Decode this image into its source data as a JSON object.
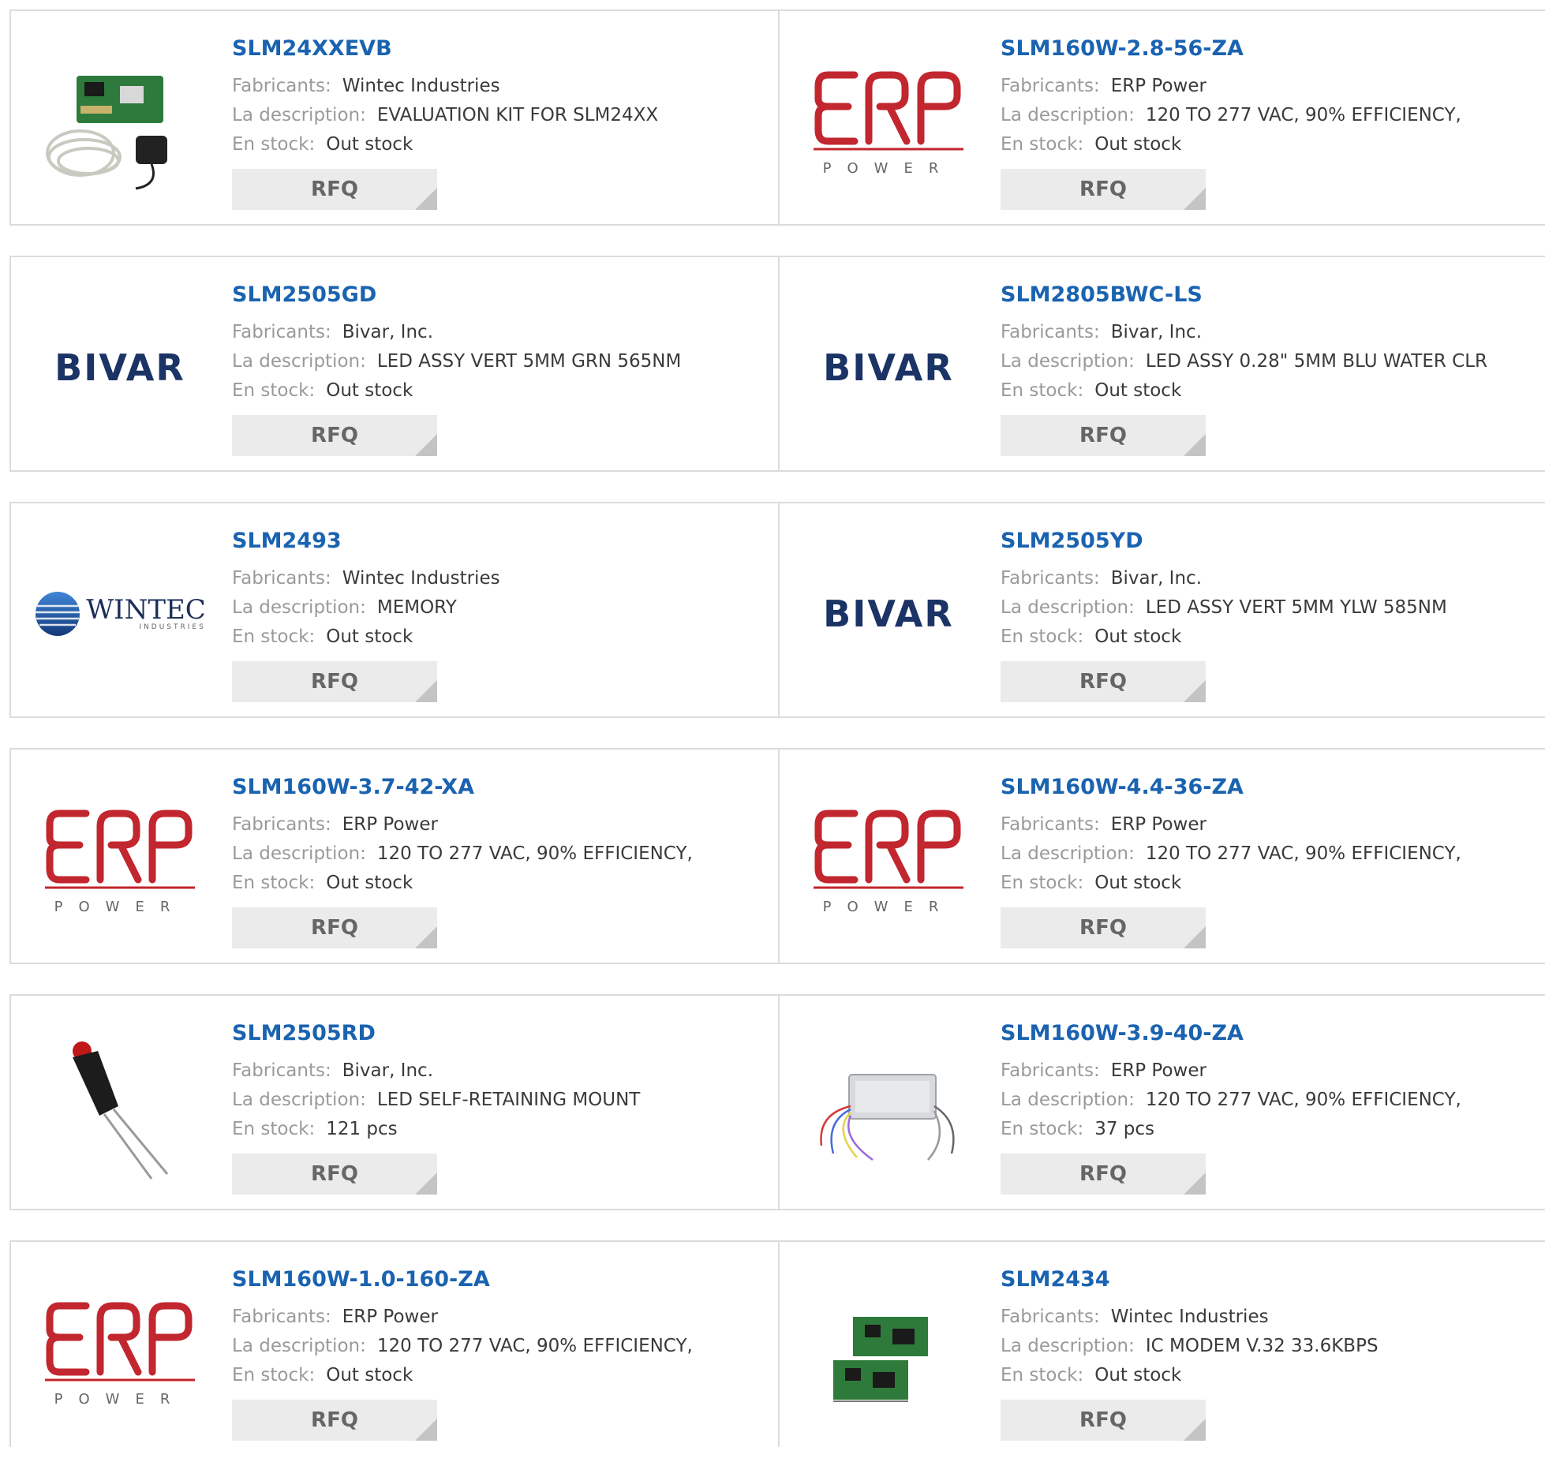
{
  "labels": {
    "manufacturer": "Fabricants:",
    "description": "La description:",
    "stock": "En stock:",
    "rfq": "RFQ"
  },
  "products": [
    {
      "pn": "SLM24XXEVB",
      "mfr": "Wintec Industries",
      "desc": "EVALUATION KIT FOR SLM24XX",
      "stock": "Out stock",
      "image": "eval-kit-photo"
    },
    {
      "pn": "SLM160W-2.8-56-ZA",
      "mfr": "ERP Power",
      "desc": "120 TO 277 VAC, 90% EFFICIENCY,",
      "stock": "Out stock",
      "image": "erp-logo"
    },
    {
      "pn": "SLM2505GD",
      "mfr": "Bivar, Inc.",
      "desc": "LED ASSY VERT 5MM GRN 565NM",
      "stock": "Out stock",
      "image": "bivar-logo"
    },
    {
      "pn": "SLM2805BWC-LS",
      "mfr": "Bivar, Inc.",
      "desc": "LED ASSY 0.28\" 5MM BLU WATER CLR",
      "stock": "Out stock",
      "image": "bivar-logo"
    },
    {
      "pn": "SLM2493",
      "mfr": "Wintec Industries",
      "desc": "MEMORY",
      "stock": "Out stock",
      "image": "wintec-logo"
    },
    {
      "pn": "SLM2505YD",
      "mfr": "Bivar, Inc.",
      "desc": "LED ASSY VERT 5MM YLW 585NM",
      "stock": "Out stock",
      "image": "bivar-logo"
    },
    {
      "pn": "SLM160W-3.7-42-XA",
      "mfr": "ERP Power",
      "desc": "120 TO 277 VAC, 90% EFFICIENCY,",
      "stock": "Out stock",
      "image": "erp-logo"
    },
    {
      "pn": "SLM160W-4.4-36-ZA",
      "mfr": "ERP Power",
      "desc": "120 TO 277 VAC, 90% EFFICIENCY,",
      "stock": "Out stock",
      "image": "erp-logo"
    },
    {
      "pn": "SLM2505RD",
      "mfr": "Bivar, Inc.",
      "desc": "LED SELF-RETAINING MOUNT",
      "stock": "121 pcs",
      "image": "led-mount-photo"
    },
    {
      "pn": "SLM160W-3.9-40-ZA",
      "mfr": "ERP Power",
      "desc": "120 TO 277 VAC, 90% EFFICIENCY,",
      "stock": "37 pcs",
      "image": "power-supply-photo"
    },
    {
      "pn": "SLM160W-1.0-160-ZA",
      "mfr": "ERP Power",
      "desc": "120 TO 277 VAC, 90% EFFICIENCY,",
      "stock": "Out stock",
      "image": "erp-logo"
    },
    {
      "pn": "SLM2434",
      "mfr": "Wintec Industries",
      "desc": "IC MODEM V.32 33.6KBPS",
      "stock": "Out stock",
      "image": "modem-photo"
    }
  ],
  "logos": {
    "bivar": "BIVAR",
    "erp": "ERP",
    "erp_sub": "POWER",
    "wintec": "WINTEC",
    "wintec_sub": "INDUSTRIES"
  },
  "colors": {
    "link": "#1a63b0",
    "erp_red": "#c2262e",
    "bivar_navy": "#1b3365"
  }
}
